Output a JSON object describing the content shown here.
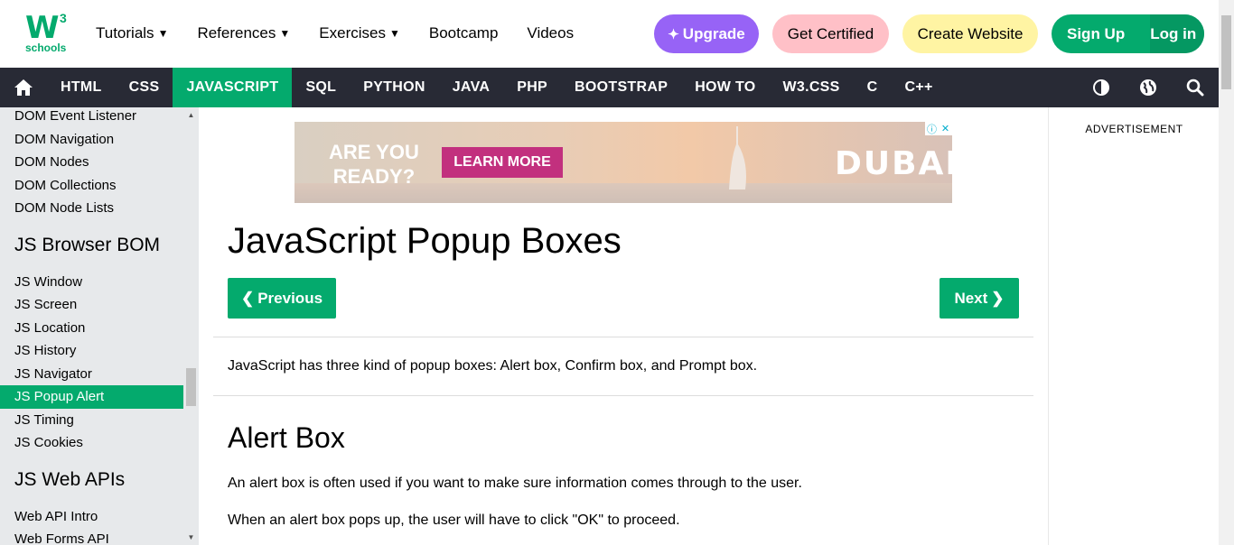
{
  "logo": {
    "mark": "W",
    "sup": "3",
    "text": "schools"
  },
  "topnav": {
    "items": [
      {
        "label": "Tutorials",
        "dropdown": true
      },
      {
        "label": "References",
        "dropdown": true
      },
      {
        "label": "Exercises",
        "dropdown": true
      },
      {
        "label": "Bootcamp",
        "dropdown": false
      },
      {
        "label": "Videos",
        "dropdown": false
      }
    ],
    "upgrade": "Upgrade",
    "certified": "Get Certified",
    "create": "Create Website",
    "signup": "Sign Up",
    "login": "Log in"
  },
  "darknav": {
    "links": [
      "HTML",
      "CSS",
      "JAVASCRIPT",
      "SQL",
      "PYTHON",
      "JAVA",
      "PHP",
      "BOOTSTRAP",
      "HOW TO",
      "W3.CSS",
      "C",
      "C++"
    ],
    "active": "JAVASCRIPT",
    "icons": [
      "home-icon",
      "contrast-icon",
      "globe-icon",
      "search-icon"
    ]
  },
  "sidebar": {
    "groups": [
      {
        "heading": null,
        "links": [
          "DOM Event Listener",
          "DOM Navigation",
          "DOM Nodes",
          "DOM Collections",
          "DOM Node Lists"
        ]
      },
      {
        "heading": "JS Browser BOM",
        "links": [
          "JS Window",
          "JS Screen",
          "JS Location",
          "JS History",
          "JS Navigator",
          "JS Popup Alert",
          "JS Timing",
          "JS Cookies"
        ]
      },
      {
        "heading": "JS Web APIs",
        "links": [
          "Web API Intro",
          "Web Forms API"
        ]
      }
    ],
    "active": "JS Popup Alert"
  },
  "ad": {
    "question_line1": "ARE YOU",
    "question_line2": "READY?",
    "cta": "LEARN MORE",
    "brand": "DUBAI"
  },
  "main": {
    "title": "JavaScript Popup Boxes",
    "prev": "Previous",
    "next": "Next",
    "intro": "JavaScript has three kind of popup boxes: Alert box, Confirm box, and Prompt box.",
    "h2": "Alert Box",
    "p1": "An alert box is often used if you want to make sure information comes through to the user.",
    "p2": "When an alert box pops up, the user will have to click \"OK\" to proceed."
  },
  "rightcol": {
    "label": "ADVERTISEMENT"
  },
  "colors": {
    "green": "#04AA6D",
    "dark": "#282A35",
    "purple": "#9763f6",
    "pink": "#ffc0c7",
    "yellow": "#fff4a3"
  }
}
